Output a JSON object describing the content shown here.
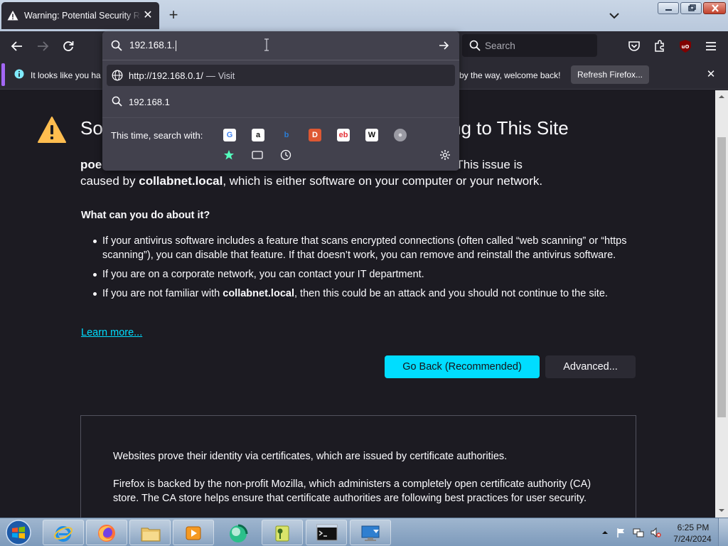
{
  "tab": {
    "title": "Warning: Potential Security Risk Ahead",
    "close": "✕"
  },
  "new_tab": "+",
  "toolbar": {
    "search_placeholder": "Search"
  },
  "notification": {
    "text_left": "It looks like you ha",
    "text_right": "by the way, welcome back!",
    "refresh_label": "Refresh Firefox...",
    "close": "✕"
  },
  "urlbar": {
    "value": "192.168.1.",
    "suggestion_url": "http://192.168.0.1/",
    "suggestion_dash": "—",
    "suggestion_action": "Visit",
    "search_suggestion": "192.168.1",
    "this_time_label": "This time, search with:"
  },
  "engines": [
    {
      "name": "google-icon",
      "glyph": "G",
      "bg": "#ffffff",
      "fg": "#4285f4"
    },
    {
      "name": "amazon-icon",
      "glyph": "a",
      "bg": "#ffffff",
      "fg": "#111111"
    },
    {
      "name": "bing-icon",
      "glyph": "b",
      "bg": "#42414d",
      "fg": "#2b7cd3"
    },
    {
      "name": "duckduckgo-icon",
      "glyph": "D",
      "bg": "#de5833",
      "fg": "#ffffff"
    },
    {
      "name": "ebay-icon",
      "glyph": "eb",
      "bg": "#ffffff",
      "fg": "#e53238"
    },
    {
      "name": "wikipedia-icon",
      "glyph": "W",
      "bg": "#ffffff",
      "fg": "#111111"
    },
    {
      "name": "search-engine-icon",
      "glyph": "●",
      "bg": "#9a9aa3",
      "fg": "#d9d9de"
    }
  ],
  "page": {
    "heading_left": "So",
    "heading_right": "cting to This Site",
    "para_start": "poe",
    "para_tail": "e established. This issue is",
    "para_line2_prefix": "caused by ",
    "para_line2_host": "collabnet.local",
    "para_line2_suffix": ", which is either software on your computer or your network.",
    "what_heading": "What can you do about it?",
    "bullet1": "If your antivirus software includes a feature that scans encrypted connections (often called “web scanning” or “https scanning”), you can disable that feature. If that doesn’t work, you can remove and reinstall the antivirus software.",
    "bullet2": "If you are on a corporate network, you can contact your IT department.",
    "bullet3_prefix": "If you are not familiar with ",
    "bullet3_host": "collabnet.local",
    "bullet3_suffix": ", then this could be an attack and you should not continue to the site.",
    "learn_more": "Learn more...",
    "go_back": "Go Back (Recommended)",
    "advanced": "Advanced...",
    "ca_para1": "Websites prove their identity via certificates, which are issued by certificate authorities.",
    "ca_para2": "Firefox is backed by the non-profit Mozilla, which administers a completely open certificate authority (CA) store. The CA store helps ensure that certificate authorities are following best practices for user security."
  },
  "taskbar": {
    "time": "6:25 PM",
    "date": "7/24/2024"
  },
  "colors": {
    "accent": "#00ddff",
    "background": "#1c1b22",
    "panel": "#42414d"
  }
}
